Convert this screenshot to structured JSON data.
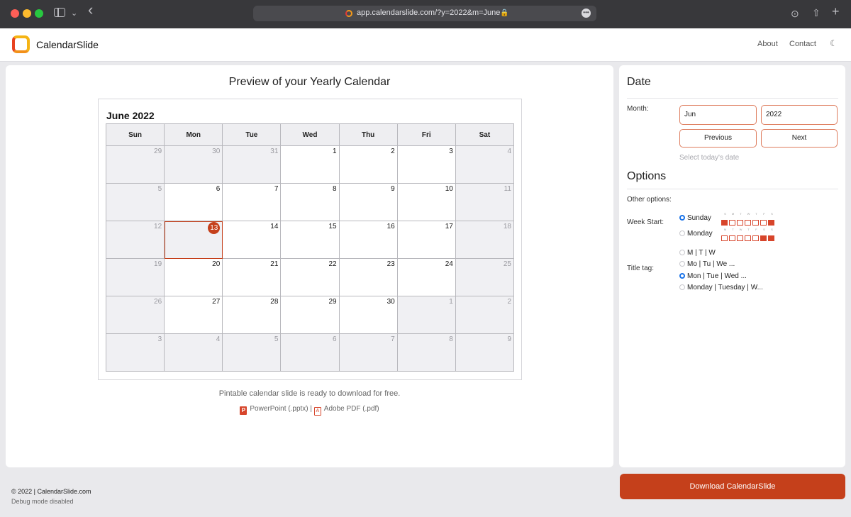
{
  "browser": {
    "url": "app.calendarslide.com/?y=2022&m=June",
    "lock_glyph": "🔒",
    "more_glyph": "•••",
    "chevron_glyph": "⌄",
    "back_glyph": "‹",
    "download_glyph": "⊙",
    "share_glyph": "⇧",
    "newtab_glyph": "+"
  },
  "header": {
    "brand": "CalendarSlide",
    "nav": [
      "About",
      "Contact"
    ],
    "moon_glyph": "☾"
  },
  "preview": {
    "title": "Preview of your Yearly Calendar",
    "calendar_title": "June 2022",
    "weekdays": [
      "Sun",
      "Mon",
      "Tue",
      "Wed",
      "Thu",
      "Fri",
      "Sat"
    ],
    "weeks": [
      [
        "29",
        "30",
        "31",
        "1",
        "2",
        "3",
        "4"
      ],
      [
        "5",
        "6",
        "7",
        "8",
        "9",
        "10",
        "11"
      ],
      [
        "12",
        "13",
        "14",
        "15",
        "16",
        "17",
        "18"
      ],
      [
        "19",
        "20",
        "21",
        "22",
        "23",
        "24",
        "25"
      ],
      [
        "26",
        "27",
        "28",
        "29",
        "30",
        "1",
        "2"
      ],
      [
        "3",
        "4",
        "5",
        "6",
        "7",
        "8",
        "9"
      ]
    ],
    "today": "13",
    "ready_text": "Pintable calendar slide is ready to download for free.",
    "ppt_icon_letter": "P",
    "pdf_icon_letter": "A",
    "pptx_link": "PowerPoint (.pptx)",
    "separator": " | ",
    "pdf_link": "Adobe PDF (.pdf)"
  },
  "date_section": {
    "heading": "Date",
    "month_label": "Month:",
    "month_value": "Jun",
    "year_value": "2022",
    "previous": "Previous",
    "next": "Next",
    "select_today": "Select today's date"
  },
  "options": {
    "heading": "Options",
    "other_label": "Other options:",
    "week_start_label": "Week Start:",
    "week_start_options": [
      "Sunday",
      "Monday"
    ],
    "week_start_selected": "Sunday",
    "sunday_letters": [
      "S",
      "M",
      "T",
      "W",
      "T",
      "F",
      "S"
    ],
    "monday_letters": [
      "M",
      "T",
      "W",
      "T",
      "F",
      "S",
      "S"
    ],
    "title_tag_label": "Title tag:",
    "title_tag_options": [
      "M | T | W",
      "Mo | Tu | We ...",
      "Mon | Tue | Wed ...",
      "Monday | Tuesday | W..."
    ],
    "title_tag_selected": "Mon | Tue | Wed ..."
  },
  "download_button": "Download CalendarSlide",
  "footer": {
    "copyright": "© 2022 | CalendarSlide.com",
    "debug": "Debug mode disabled"
  },
  "colors": {
    "accent": "#c5401b",
    "field_border": "#de7d5e",
    "radio_selected": "#1a73e8"
  }
}
